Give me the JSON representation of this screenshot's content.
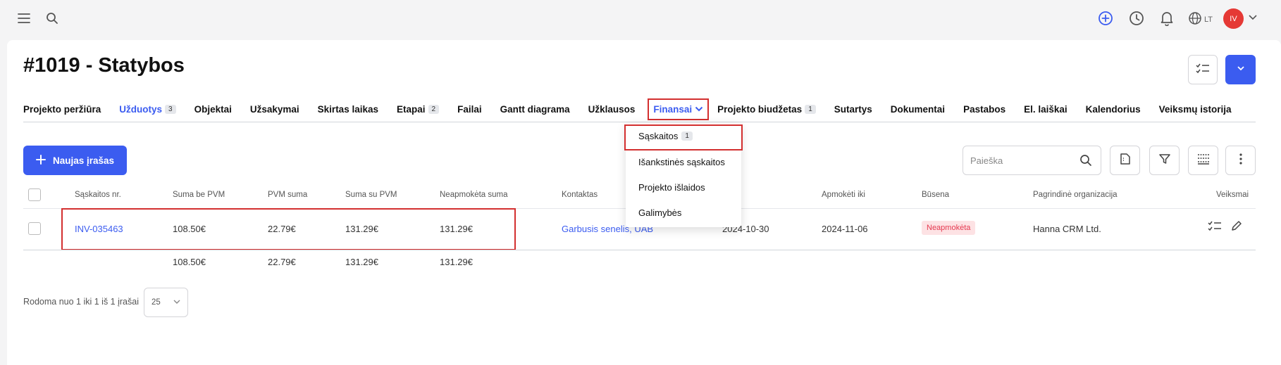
{
  "topbar": {
    "menu_icon": "menu-icon",
    "search_icon": "search-icon",
    "add_icon": "plus-circle-icon",
    "clock_icon": "clock-icon",
    "bell_icon": "bell-icon",
    "globe_icon": "globe-icon",
    "language": "LT",
    "avatar_initials": "IV",
    "accent": "#3b5cf0"
  },
  "page": {
    "title": "#1019 - Statybos"
  },
  "tabs": [
    {
      "label": "Projekto peržiūra",
      "badge": ""
    },
    {
      "label": "Užduotys",
      "badge": "3"
    },
    {
      "label": "Objektai",
      "badge": ""
    },
    {
      "label": "Užsakymai",
      "badge": ""
    },
    {
      "label": "Skirtas laikas",
      "badge": ""
    },
    {
      "label": "Etapai",
      "badge": "2"
    },
    {
      "label": "Failai",
      "badge": ""
    },
    {
      "label": "Gantt diagrama",
      "badge": ""
    },
    {
      "label": "Užklausos",
      "badge": ""
    },
    {
      "label": "Finansai",
      "badge": ""
    },
    {
      "label": "Projekto biudžetas",
      "badge": "1"
    },
    {
      "label": "Sutartys",
      "badge": ""
    },
    {
      "label": "Dokumentai",
      "badge": ""
    },
    {
      "label": "Pastabos",
      "badge": ""
    },
    {
      "label": "El. laiškai",
      "badge": ""
    },
    {
      "label": "Kalendorius",
      "badge": ""
    },
    {
      "label": "Veiksmų istorija",
      "badge": ""
    }
  ],
  "dropdown": {
    "items": [
      {
        "label": "Sąskaitos",
        "badge": "1"
      },
      {
        "label": "Išankstinės sąskaitos",
        "badge": ""
      },
      {
        "label": "Projekto išlaidos",
        "badge": ""
      },
      {
        "label": "Galimybės",
        "badge": ""
      }
    ]
  },
  "toolbar": {
    "new_label": "Naujas įrašas",
    "search_placeholder": "Paieška"
  },
  "table": {
    "headers": [
      "Sąskaitos nr.",
      "Suma be PVM",
      "PVM suma",
      "Suma su PVM",
      "Neapmokėta suma",
      "Kontaktas",
      "Apmokėti iki",
      "Būsena",
      "Pagrindinė organizacija",
      "Veiksmai"
    ],
    "row": {
      "number": "INV-035463",
      "sum_no_vat": "108.50€",
      "vat": "22.79€",
      "sum_with_vat": "131.29€",
      "unpaid": "131.29€",
      "contact": "Garbusis senelis, UAB",
      "date": "2024-10-30",
      "due": "2024-11-06",
      "status": "Neapmokėta",
      "organization": "Hanna CRM Ltd."
    },
    "totals": {
      "sum_no_vat": "108.50€",
      "vat": "22.79€",
      "sum_with_vat": "131.29€",
      "unpaid": "131.29€"
    }
  },
  "pager": {
    "text": "Rodoma nuo 1 iki 1 iš 1 įrašai",
    "page_size": "25"
  }
}
